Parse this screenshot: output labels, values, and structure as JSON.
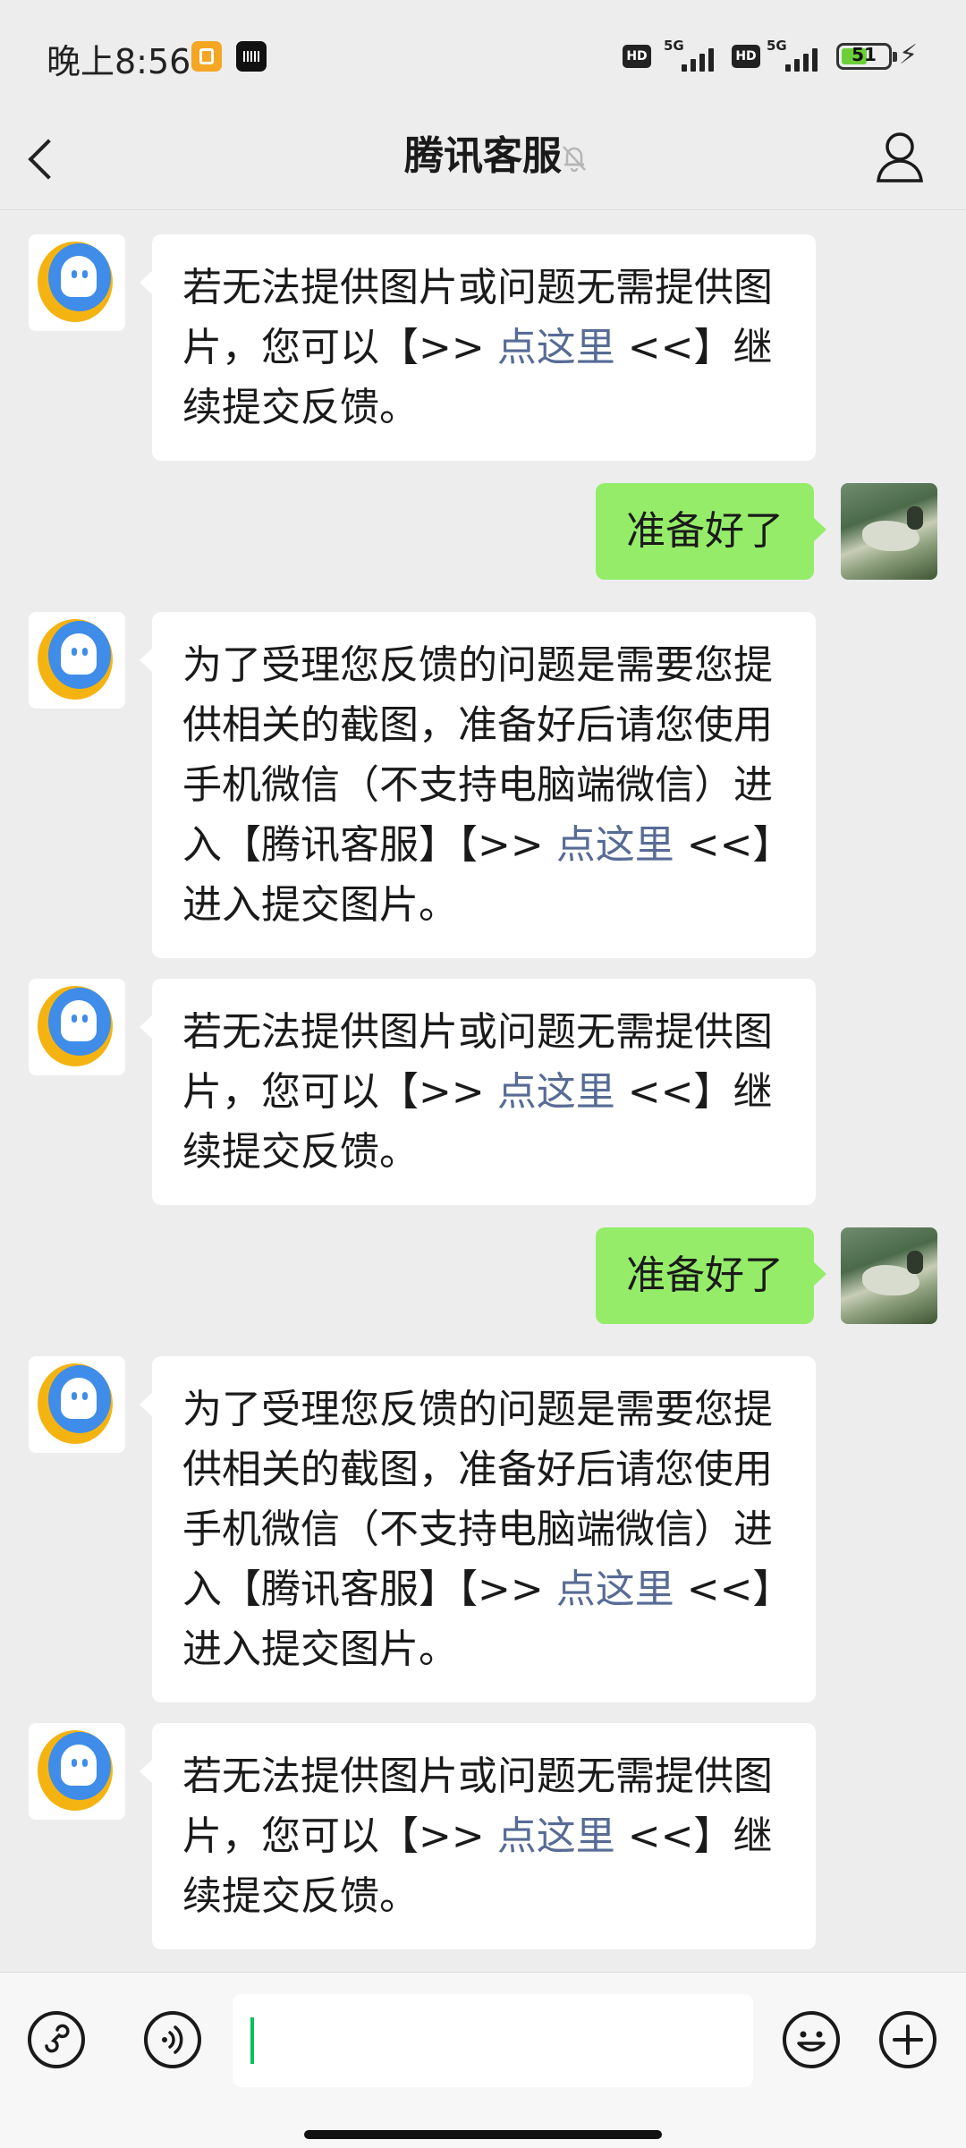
{
  "status_bar": {
    "time": "晚上8:56",
    "hd1": "HD",
    "net1": "5G",
    "hd2": "HD",
    "net2": "5G",
    "battery": "51",
    "charging_icon": "bolt-icon"
  },
  "nav": {
    "title": "腾讯客服",
    "back_icon": "chevron-left-icon",
    "mute_icon": "bell-off-icon",
    "profile_icon": "person-icon"
  },
  "messages": [
    {
      "side": "in",
      "parts": [
        "若无法提供图片或问题无需提供图片，您可以【>> ",
        "点这里",
        " <<】继续提交反馈。"
      ]
    },
    {
      "side": "out",
      "text": "准备好了"
    },
    {
      "side": "in",
      "parts": [
        "为了受理您反馈的问题是需要您提供相关的截图，准备好后请您使用手机微信（不支持电脑端微信）进入【腾讯客服】【>> ",
        "点这里",
        " <<】进入提交图片。"
      ]
    },
    {
      "side": "in",
      "parts": [
        "若无法提供图片或问题无需提供图片，您可以【>> ",
        "点这里",
        " <<】继续提交反馈。"
      ]
    },
    {
      "side": "out",
      "text": "准备好了"
    },
    {
      "side": "in",
      "parts": [
        "为了受理您反馈的问题是需要您提供相关的截图，准备好后请您使用手机微信（不支持电脑端微信）进入【腾讯客服】【>> ",
        "点这里",
        " <<】进入提交图片。"
      ]
    },
    {
      "side": "in",
      "parts": [
        "若无法提供图片或问题无需提供图片，您可以【>> ",
        "点这里",
        " <<】继续提交反馈。"
      ]
    }
  ],
  "input_bar": {
    "left_icons": [
      "mini-program-icon",
      "voice-icon"
    ],
    "text_value": "",
    "right_icons": [
      "emoji-icon",
      "plus-icon"
    ]
  },
  "colors": {
    "background": "#ededed",
    "outgoing_bubble": "#95ec69",
    "incoming_bubble": "#ffffff",
    "link": "#576b95",
    "caret": "#07c160"
  }
}
